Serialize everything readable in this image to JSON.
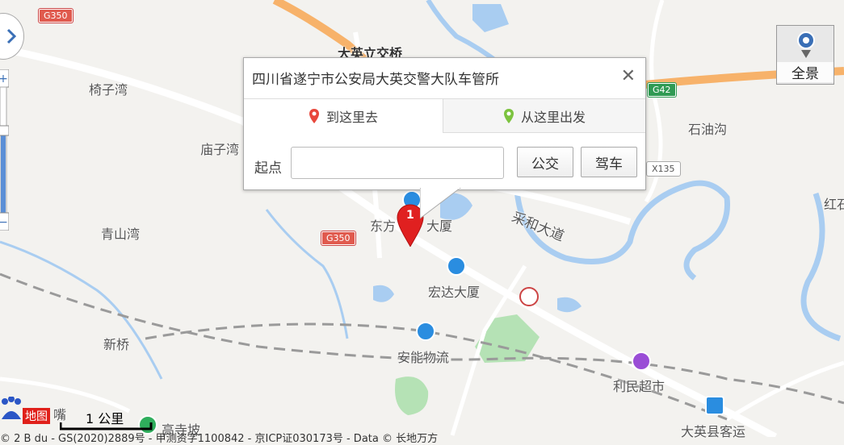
{
  "map": {
    "labels": {
      "dayingli": "大英立交桥",
      "yizi": "椅子湾",
      "miaozi": "庙子湾",
      "qingshan": "青山湾",
      "xinqiao": "新桥",
      "dongfang": "东方",
      "dasha1": "大厦",
      "hongda": "宏达大厦",
      "anneng": "安能物流",
      "limin": "利民超市",
      "keyun": "大英县客运",
      "gaosipo": "高寺坡",
      "shiyou": "石油沟",
      "caihe": "采和大道",
      "hong": "红石",
      "zui": "嘴"
    },
    "shields": {
      "g350_top": "G350",
      "g350_mid": "G350",
      "g42": "G42",
      "x135": "X135"
    },
    "marker_label": "1",
    "colors": {
      "highway": "#f7b26a",
      "water": "#a9cdf1",
      "green": "#b5e2b5",
      "road": "#ffffff",
      "rail": "#9a9a9a",
      "marker": "#e02020"
    }
  },
  "popup": {
    "title": "四川省遂宁市公安局大英交警大队车管所",
    "close": "✕",
    "tab_go": "到这里去",
    "tab_from": "从这里出发",
    "start_label": "起点",
    "start_value": "",
    "transit_button": "公交",
    "drive_button": "驾车"
  },
  "controls": {
    "panorama_label": "全景",
    "scale_label": "1 公里",
    "logo_text": "地图",
    "copyright": "© 2 B du - GS(2020)2889号 - 甲测资字1100842 - 京ICP证030173号 - Data © 长地万方"
  }
}
